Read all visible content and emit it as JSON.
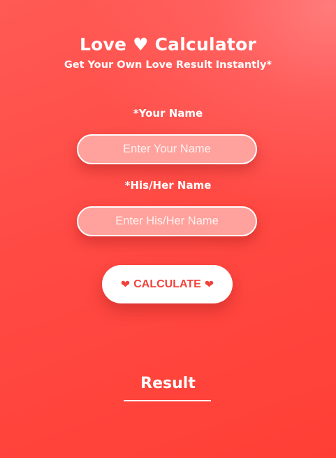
{
  "header": {
    "title": "Love ♥ Calculator",
    "subtitle": "Get Your Own Love Result Instantly*"
  },
  "form": {
    "your_name_label": "*Your Name",
    "your_name_placeholder": "Enter Your Name",
    "your_name_value": "",
    "partner_name_label": "*His/Her Name",
    "partner_name_placeholder": "Enter His/Her Name",
    "partner_name_value": "",
    "calculate_label": "CALCULATE",
    "calculate_icons": [
      "heart-icon",
      "heart-icon"
    ]
  },
  "result": {
    "heading": "Result"
  },
  "colors": {
    "background": "#ff4a44",
    "background_highlight": "#ff7d7d",
    "input_fill": "#ffa19c",
    "button_background": "#ffffff",
    "button_text": "#f0433c",
    "text": "#ffffff"
  }
}
